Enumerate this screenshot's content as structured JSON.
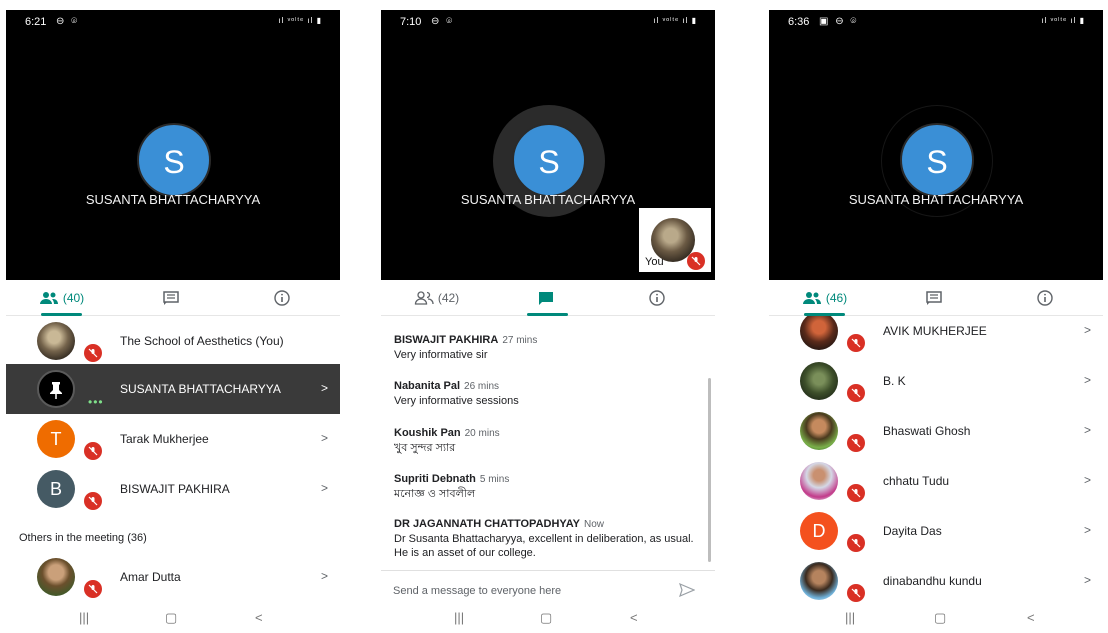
{
  "colors": {
    "accent": "#00897b",
    "mute_red": "#d93025",
    "avatar_blue": "#3a8fd6"
  },
  "nav_icons": [
    "recents-icon",
    "home-icon",
    "back-icon"
  ],
  "screens": [
    {
      "status": {
        "time": "6:21",
        "icons": "⊖ ⌾",
        "net": "ıl  ᵛᵒˡᵗᵉ ıl ▮"
      },
      "speaker": {
        "initial": "S",
        "name": "SUSANTA BHATTACHARYYA"
      },
      "tabs": {
        "people": "(40)"
      },
      "people": [
        {
          "name": "The School of Aesthetics (You)"
        },
        {
          "name": "SUSANTA BHATTACHARYYA"
        },
        {
          "name": "Tarak Mukherjee",
          "initial": "T"
        },
        {
          "name": "BISWAJIT PAKHIRA",
          "initial": "B"
        }
      ],
      "others_label": "Others in the meeting (36)",
      "others": [
        {
          "name": "Amar Dutta"
        }
      ]
    },
    {
      "status": {
        "time": "7:10",
        "icons": "⊖ ⌾",
        "net": "ıl  ᵛᵒˡᵗᵉ ıl ▮"
      },
      "speaker": {
        "initial": "S",
        "name": "SUSANTA BHATTACHARYYA"
      },
      "self_label": "You",
      "tabs": {
        "people": "(42)"
      },
      "messages": [
        {
          "sender": "BISWAJIT PAKHIRA",
          "time": "27 mins",
          "text": "Very informative sir"
        },
        {
          "sender": "Nabanita Pal",
          "time": "26 mins",
          "text": "Very informative sessions"
        },
        {
          "sender": "Koushik Pan",
          "time": "20 mins",
          "text": "খুব সুন্দর স্যার"
        },
        {
          "sender": "Supriti Debnath",
          "time": "5 mins",
          "text": "মনোজ্ঞ ও সাবলীল"
        },
        {
          "sender": "DR JAGANNATH CHATTOPADHYAY",
          "time": "Now",
          "text": "Dr Susanta Bhattacharyya, excellent in deliberation, as usual. He is an asset of our college."
        }
      ],
      "compose_placeholder": "Send a message to everyone here"
    },
    {
      "status": {
        "time": "6:36",
        "icons": "▣ ⊖ ⌾",
        "net": "ıl  ᵛᵒˡᵗᵉ ıl ▮"
      },
      "speaker": {
        "initial": "S",
        "name": "SUSANTA BHATTACHARYYA"
      },
      "tabs": {
        "people": "(46)"
      },
      "people": [
        {
          "name": "AVIK MUKHERJEE"
        },
        {
          "name": "B. K"
        },
        {
          "name": "Bhaswati Ghosh"
        },
        {
          "name": "chhatu Tudu"
        },
        {
          "name": "Dayita Das",
          "initial": "D"
        },
        {
          "name": "dinabandhu kundu"
        }
      ]
    }
  ]
}
